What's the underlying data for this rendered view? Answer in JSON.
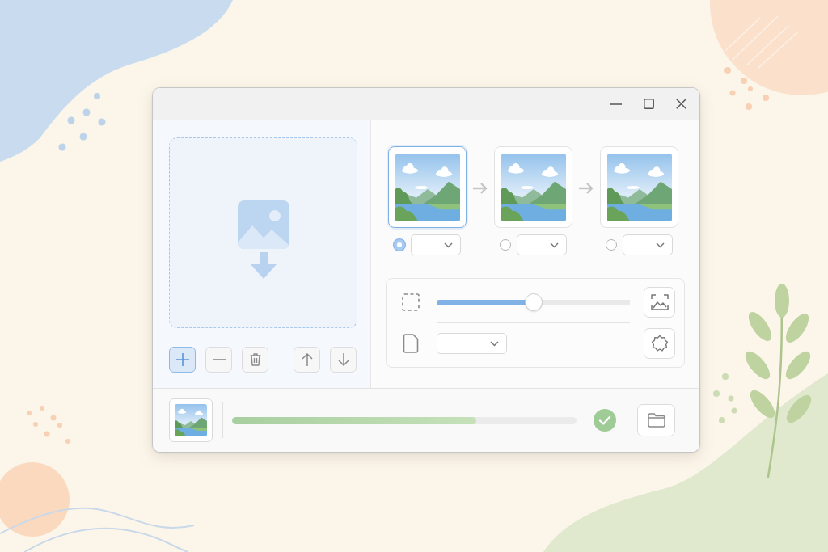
{
  "window": {
    "controls": [
      {
        "kind": "minimize"
      },
      {
        "kind": "maximize"
      },
      {
        "kind": "close"
      }
    ]
  },
  "list_buttons": [
    {
      "kind": "add",
      "active": true
    },
    {
      "kind": "remove",
      "active": false
    },
    {
      "kind": "delete",
      "active": false
    }
  ],
  "order_buttons": [
    {
      "kind": "move-up",
      "active": false
    },
    {
      "kind": "move-down",
      "active": false
    }
  ],
  "steps": [
    {
      "selected": true
    },
    {
      "selected": false
    },
    {
      "selected": false
    }
  ],
  "adjustments": {
    "rows": [
      {
        "kind": "slider",
        "level": 0.5,
        "button": {
          "kind": "image"
        }
      },
      {
        "kind": "dropdown",
        "button": {
          "kind": "settings"
        }
      }
    ]
  },
  "footer": {
    "progress": {
      "level": 0.71
    },
    "complete": true
  }
}
